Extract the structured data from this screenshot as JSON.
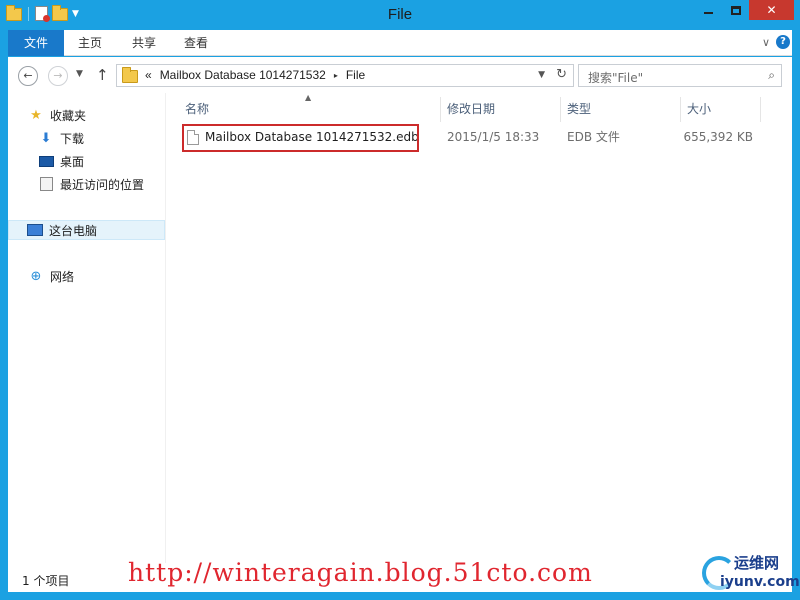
{
  "window": {
    "title": "File",
    "controls": {
      "minimize": "",
      "maximize": "",
      "close": "✕"
    }
  },
  "ribbon": {
    "tabs": [
      "文件",
      "主页",
      "共享",
      "查看"
    ],
    "expand_icon": "chevron-down-icon",
    "help_label": "?"
  },
  "address": {
    "overflow": "«",
    "crumbs": [
      "Mailbox Database 1014271532",
      "File"
    ],
    "separator": "▸"
  },
  "search": {
    "placeholder": "搜索\"File\""
  },
  "nav_pane": {
    "favorites": "收藏夹",
    "downloads": "下载",
    "desktop": "桌面",
    "recent": "最近访问的位置",
    "this_pc": "这台电脑",
    "network": "网络"
  },
  "columns": {
    "name": "名称",
    "modified": "修改日期",
    "type": "类型",
    "size": "大小"
  },
  "files": [
    {
      "name": "Mailbox Database 1014271532.edb",
      "modified": "2015/1/5 18:33",
      "type": "EDB 文件",
      "size": "655,392 KB"
    }
  ],
  "status": {
    "item_count": "1 个项目"
  },
  "watermark": {
    "url": "http://winteragain.blog.51cto.com",
    "logo_top": "运维网",
    "logo_bottom": "iyunv.com"
  },
  "colors": {
    "title_bar": "#1ba1e2",
    "file_tab": "#1979ca",
    "close_button": "#c7382e",
    "highlight_border": "#cc2b2b",
    "watermark": "#e0262f"
  }
}
